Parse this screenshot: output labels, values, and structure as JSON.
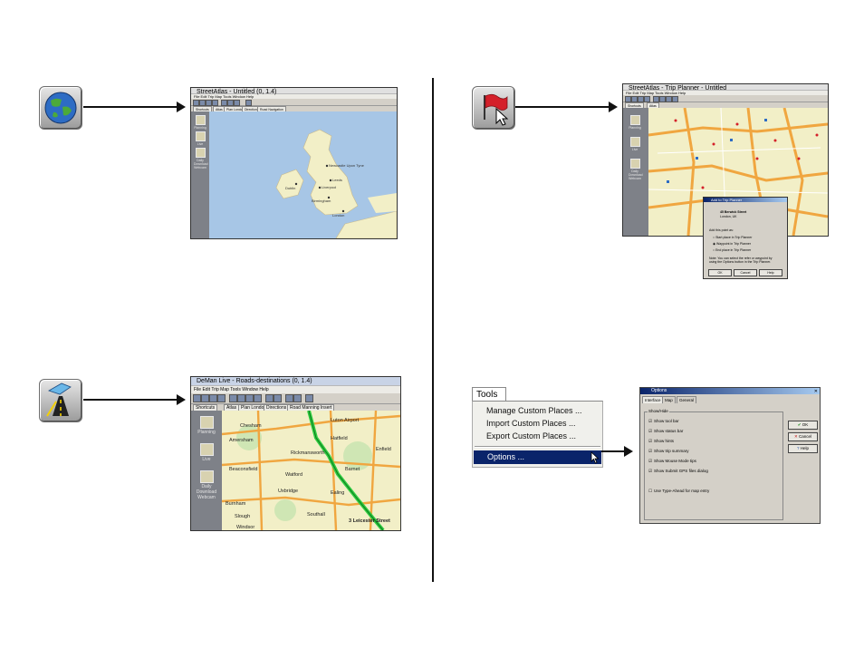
{
  "panel_globe": {
    "icon": "globe-icon",
    "screenshot": {
      "title": "StreetAtlas - Untitled (0, 1.4)",
      "menu": "File  Edit  Trip  Map  Tools  Window  Help",
      "tabs": [
        "Shortcuts",
        "Atlas",
        "Plan London",
        "Directions",
        "Road Navigation"
      ],
      "sidebar": [
        "Planning",
        "Live",
        "Daily Download Webcam"
      ],
      "places": [
        "Newcastle Upon Tyne",
        "Leeds",
        "Liverpool",
        "Birmingham",
        "London",
        "Dublin"
      ]
    }
  },
  "panel_flag": {
    "icon": "add-place-flag-icon",
    "screenshot": {
      "title": "StreetAtlas - Trip Planner - Untitled",
      "menu": "File  Edit  Trip  Map  Tools  Window  Help",
      "tabs": [
        "Shortcuts",
        "Atlas"
      ],
      "sidebar": [
        "Planning",
        "Live",
        "Daily Download Webcam"
      ]
    },
    "dialog": {
      "title": "Add to Trip Planner",
      "address": [
        "45 Berwick Street",
        "London, UK"
      ],
      "prompt": "Add this point as:",
      "options": [
        "Start place in Trip Planner",
        "Waypoint in Trip Planner",
        "End place in Trip Planner"
      ],
      "note": [
        "Note: You can select the refer or waypoint by",
        "using the Options button in the Trip Planner."
      ],
      "buttons": [
        "OK",
        "Cancel",
        "Help"
      ]
    }
  },
  "panel_route": {
    "icon": "route-road-icon",
    "screenshot": {
      "title": "DeMan Live - Roads-destinations (0, 1.4)",
      "menu": "File  Edit  Trip  Map  Tools  Window  Help",
      "tabs": [
        "Shortcuts",
        "Atlas",
        "Plan London",
        "Directions",
        "Road Manning Insert"
      ],
      "sidebar": [
        "Planning",
        "Live",
        "Daily Download Webcam"
      ],
      "places": [
        "Luton Airport",
        "Chesham",
        "Amersham",
        "Hatfield",
        "Enfield",
        "Rickmansworth",
        "Beaconsfield",
        "Watford",
        "Uxbridge",
        "Barnet",
        "Burnham",
        "Slough",
        "Southall",
        "Windsor",
        "Ealing"
      ],
      "destination": "3 Leicester Street"
    }
  },
  "tools_menu": {
    "header": "Tools",
    "items": [
      "Manage Custom Places ...",
      "Import Custom Places ...",
      "Export Custom Places ..."
    ],
    "selected": "Options ..."
  },
  "options_dialog": {
    "title": "Options",
    "tabs": [
      "Interface",
      "Map",
      "General"
    ],
    "group": "Show/Hide",
    "checks_on": [
      "Show tool bar",
      "Show status bar",
      "Show hints",
      "Show trip summary"
    ],
    "check_mouse": "Show Mouse Mode tips",
    "check_gps": "Show Submit GPS files dialog",
    "check_off": "Use Type-Ahead for map entry",
    "buttons": [
      "OK",
      "Cancel",
      "Help"
    ]
  },
  "colors": {
    "land": "#f2efc7",
    "water": "#a7c6e6",
    "road": "#f0a640",
    "route": "#2ecc40",
    "selection": "#0a246a"
  }
}
